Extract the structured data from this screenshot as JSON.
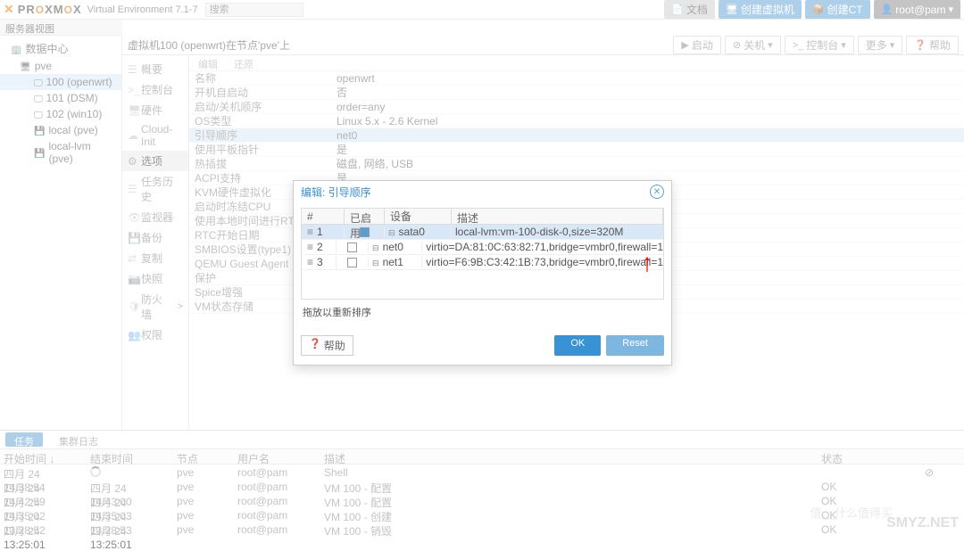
{
  "header": {
    "logo": "PROXMOX",
    "version": "Virtual Environment 7.1-7",
    "search_ph": "搜索",
    "btn_doc": "文档",
    "btn_createvm": "创建虚拟机",
    "btn_createct": "创建CT",
    "btn_user": "root@pam"
  },
  "tree": {
    "header": "服务器视图",
    "dc": "数据中心",
    "pve": "pve",
    "vm100": "100 (openwrt)",
    "vm101": "101 (DSM)",
    "vm102": "102 (win10)",
    "local": "local (pve)",
    "locallvm": "local-lvm (pve)"
  },
  "content": {
    "breadcrumb": "虚拟机100 (openwrt)在节点'pve'上",
    "btn_start": "启动",
    "btn_shut": "关机",
    "btn_console": "控制台",
    "btn_more": "更多",
    "btn_help": "帮助"
  },
  "submenu": {
    "summary": "概要",
    "console": "控制台",
    "hardware": "硬件",
    "cloudinit": "Cloud-Init",
    "options": "选项",
    "history": "任务历史",
    "monitor": "监视器",
    "backup": "备份",
    "replication": "复制",
    "snapshot": "快照",
    "firewall": "防火墙",
    "permissions": "权限"
  },
  "toolbar": {
    "edit": "编辑",
    "restore": "还原"
  },
  "opts": [
    {
      "k": "名称",
      "v": "openwrt"
    },
    {
      "k": "开机自启动",
      "v": "否"
    },
    {
      "k": "启动/关机顺序",
      "v": "order=any"
    },
    {
      "k": "OS类型",
      "v": "Linux 5.x - 2.6 Kernel"
    },
    {
      "k": "引导顺序",
      "v": "net0",
      "hl": true
    },
    {
      "k": "使用平板指针",
      "v": "是"
    },
    {
      "k": "热插拔",
      "v": "磁盘, 网络, USB"
    },
    {
      "k": "ACPI支持",
      "v": "是"
    },
    {
      "k": "KVM硬件虚拟化",
      "v": ""
    },
    {
      "k": "启动时冻结CPU",
      "v": ""
    },
    {
      "k": "使用本地时间进行RTC",
      "v": ""
    },
    {
      "k": "RTC开始日期",
      "v": ""
    },
    {
      "k": "SMBIOS设置(type1)",
      "v": ""
    },
    {
      "k": "QEMU Guest Agent",
      "v": ""
    },
    {
      "k": "保护",
      "v": ""
    },
    {
      "k": "Spice增强",
      "v": ""
    },
    {
      "k": "VM状态存储",
      "v": ""
    }
  ],
  "modal": {
    "title": "编辑: 引导顺序",
    "col_num": "#",
    "col_en": "已启用",
    "col_dev": "设备",
    "col_desc": "描述",
    "rows": [
      {
        "n": "1",
        "en": true,
        "dev": "sata0",
        "desc": "local-lvm:vm-100-disk-0,size=320M",
        "sel": true
      },
      {
        "n": "2",
        "en": false,
        "dev": "net0",
        "desc": "virtio=DA:81:0C:63:82:71,bridge=vmbr0,firewall=1"
      },
      {
        "n": "3",
        "en": false,
        "dev": "net1",
        "desc": "virtio=F6:9B:C3:42:1B:73,bridge=vmbr0,firewall=1"
      }
    ],
    "hint": "拖放以重新排序",
    "btn_help": "帮助",
    "btn_ok": "OK",
    "btn_reset": "Reset"
  },
  "log": {
    "tab_tasks": "任务",
    "tab_cluster": "集群日志",
    "h_start": "开始时间 ↓",
    "h_end": "结束时间",
    "h_node": "节点",
    "h_user": "用户名",
    "h_desc": "描述",
    "h_status": "状态",
    "rows": [
      {
        "s": "四月 24 14:38:54",
        "e": "",
        "n": "pve",
        "u": "root@pam",
        "d": "Shell",
        "st": "",
        "spin": true
      },
      {
        "s": "四月 24 14:42:59",
        "e": "四月 24 14:43:00",
        "n": "pve",
        "u": "root@pam",
        "d": "VM 100 - 配置",
        "st": "OK"
      },
      {
        "s": "四月 24 14:35:02",
        "e": "四月 24 14:35:03",
        "n": "pve",
        "u": "root@pam",
        "d": "VM 100 - 配置",
        "st": "OK"
      },
      {
        "s": "四月 24 13:28:52",
        "e": "四月 24 13:28:53",
        "n": "pve",
        "u": "root@pam",
        "d": "VM 100 - 创建",
        "st": "OK"
      },
      {
        "s": "四月 24 13:25:01",
        "e": "四月 24 13:25:01",
        "n": "pve",
        "u": "root@pam",
        "d": "VM 100 - 销毁",
        "st": "OK"
      }
    ]
  },
  "watermark": "SMYZ.NET",
  "watermark2": "值__什么值得买"
}
